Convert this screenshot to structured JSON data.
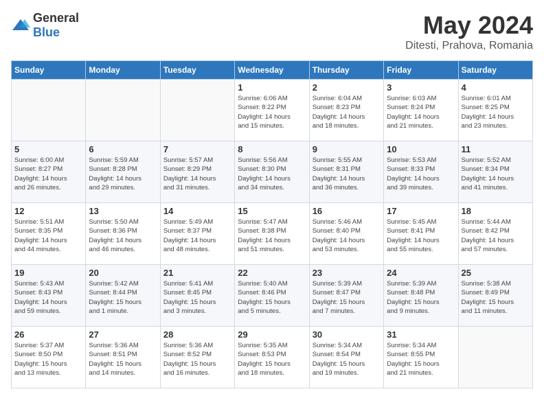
{
  "header": {
    "logo_general": "General",
    "logo_blue": "Blue",
    "title": "May 2024",
    "location": "Ditesti, Prahova, Romania"
  },
  "weekdays": [
    "Sunday",
    "Monday",
    "Tuesday",
    "Wednesday",
    "Thursday",
    "Friday",
    "Saturday"
  ],
  "weeks": [
    [
      {
        "day": "",
        "info": ""
      },
      {
        "day": "",
        "info": ""
      },
      {
        "day": "",
        "info": ""
      },
      {
        "day": "1",
        "info": "Sunrise: 6:06 AM\nSunset: 8:22 PM\nDaylight: 14 hours\nand 15 minutes."
      },
      {
        "day": "2",
        "info": "Sunrise: 6:04 AM\nSunset: 8:23 PM\nDaylight: 14 hours\nand 18 minutes."
      },
      {
        "day": "3",
        "info": "Sunrise: 6:03 AM\nSunset: 8:24 PM\nDaylight: 14 hours\nand 21 minutes."
      },
      {
        "day": "4",
        "info": "Sunrise: 6:01 AM\nSunset: 8:25 PM\nDaylight: 14 hours\nand 23 minutes."
      }
    ],
    [
      {
        "day": "5",
        "info": "Sunrise: 6:00 AM\nSunset: 8:27 PM\nDaylight: 14 hours\nand 26 minutes."
      },
      {
        "day": "6",
        "info": "Sunrise: 5:59 AM\nSunset: 8:28 PM\nDaylight: 14 hours\nand 29 minutes."
      },
      {
        "day": "7",
        "info": "Sunrise: 5:57 AM\nSunset: 8:29 PM\nDaylight: 14 hours\nand 31 minutes."
      },
      {
        "day": "8",
        "info": "Sunrise: 5:56 AM\nSunset: 8:30 PM\nDaylight: 14 hours\nand 34 minutes."
      },
      {
        "day": "9",
        "info": "Sunrise: 5:55 AM\nSunset: 8:31 PM\nDaylight: 14 hours\nand 36 minutes."
      },
      {
        "day": "10",
        "info": "Sunrise: 5:53 AM\nSunset: 8:33 PM\nDaylight: 14 hours\nand 39 minutes."
      },
      {
        "day": "11",
        "info": "Sunrise: 5:52 AM\nSunset: 8:34 PM\nDaylight: 14 hours\nand 41 minutes."
      }
    ],
    [
      {
        "day": "12",
        "info": "Sunrise: 5:51 AM\nSunset: 8:35 PM\nDaylight: 14 hours\nand 44 minutes."
      },
      {
        "day": "13",
        "info": "Sunrise: 5:50 AM\nSunset: 8:36 PM\nDaylight: 14 hours\nand 46 minutes."
      },
      {
        "day": "14",
        "info": "Sunrise: 5:49 AM\nSunset: 8:37 PM\nDaylight: 14 hours\nand 48 minutes."
      },
      {
        "day": "15",
        "info": "Sunrise: 5:47 AM\nSunset: 8:38 PM\nDaylight: 14 hours\nand 51 minutes."
      },
      {
        "day": "16",
        "info": "Sunrise: 5:46 AM\nSunset: 8:40 PM\nDaylight: 14 hours\nand 53 minutes."
      },
      {
        "day": "17",
        "info": "Sunrise: 5:45 AM\nSunset: 8:41 PM\nDaylight: 14 hours\nand 55 minutes."
      },
      {
        "day": "18",
        "info": "Sunrise: 5:44 AM\nSunset: 8:42 PM\nDaylight: 14 hours\nand 57 minutes."
      }
    ],
    [
      {
        "day": "19",
        "info": "Sunrise: 5:43 AM\nSunset: 8:43 PM\nDaylight: 14 hours\nand 59 minutes."
      },
      {
        "day": "20",
        "info": "Sunrise: 5:42 AM\nSunset: 8:44 PM\nDaylight: 15 hours\nand 1 minute."
      },
      {
        "day": "21",
        "info": "Sunrise: 5:41 AM\nSunset: 8:45 PM\nDaylight: 15 hours\nand 3 minutes."
      },
      {
        "day": "22",
        "info": "Sunrise: 5:40 AM\nSunset: 8:46 PM\nDaylight: 15 hours\nand 5 minutes."
      },
      {
        "day": "23",
        "info": "Sunrise: 5:39 AM\nSunset: 8:47 PM\nDaylight: 15 hours\nand 7 minutes."
      },
      {
        "day": "24",
        "info": "Sunrise: 5:39 AM\nSunset: 8:48 PM\nDaylight: 15 hours\nand 9 minutes."
      },
      {
        "day": "25",
        "info": "Sunrise: 5:38 AM\nSunset: 8:49 PM\nDaylight: 15 hours\nand 11 minutes."
      }
    ],
    [
      {
        "day": "26",
        "info": "Sunrise: 5:37 AM\nSunset: 8:50 PM\nDaylight: 15 hours\nand 13 minutes."
      },
      {
        "day": "27",
        "info": "Sunrise: 5:36 AM\nSunset: 8:51 PM\nDaylight: 15 hours\nand 14 minutes."
      },
      {
        "day": "28",
        "info": "Sunrise: 5:36 AM\nSunset: 8:52 PM\nDaylight: 15 hours\nand 16 minutes."
      },
      {
        "day": "29",
        "info": "Sunrise: 5:35 AM\nSunset: 8:53 PM\nDaylight: 15 hours\nand 18 minutes."
      },
      {
        "day": "30",
        "info": "Sunrise: 5:34 AM\nSunset: 8:54 PM\nDaylight: 15 hours\nand 19 minutes."
      },
      {
        "day": "31",
        "info": "Sunrise: 5:34 AM\nSunset: 8:55 PM\nDaylight: 15 hours\nand 21 minutes."
      },
      {
        "day": "",
        "info": ""
      }
    ]
  ]
}
